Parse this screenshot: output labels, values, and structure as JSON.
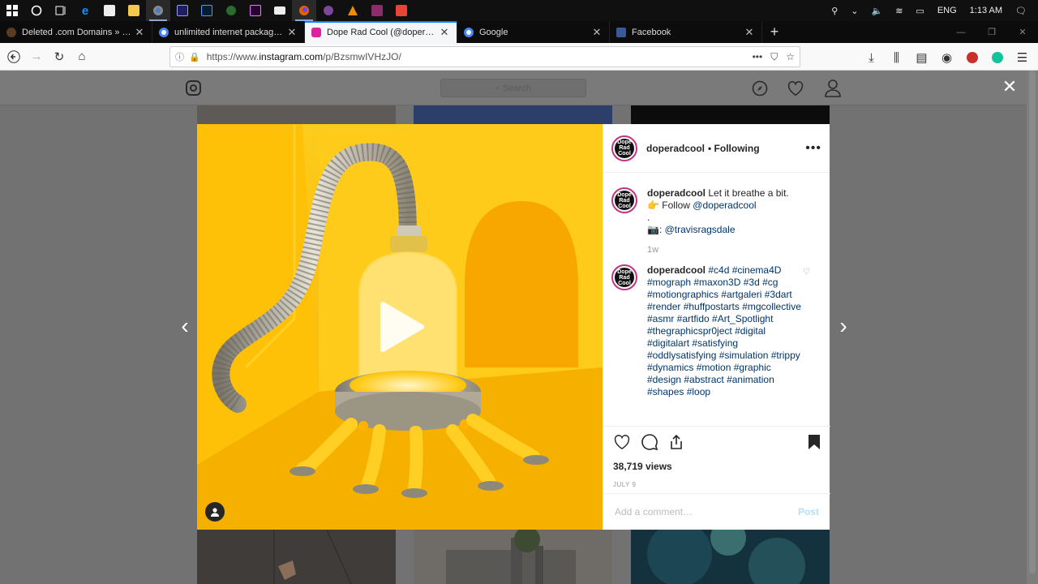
{
  "taskbar": {
    "icons": [
      "windows-start",
      "cortana-search",
      "task-view",
      "edge",
      "store",
      "file-explorer",
      "chrome",
      "after-effects",
      "photoshop",
      "corel",
      "premiere",
      "mail",
      "firefox",
      "tor",
      "vlc",
      "winrar",
      "app"
    ],
    "tray": {
      "lang": "ENG",
      "time": "1:13 AM"
    }
  },
  "tabs": [
    {
      "title": "Deleted .com Domains » Expir",
      "favicon_color": "#5b3b26",
      "active": false
    },
    {
      "title": "unlimited internet package - G",
      "favicon_color": "#4285f4",
      "active": false
    },
    {
      "title": "Dope Rad Cool (@doperadcoo",
      "favicon_color": "#d6249f",
      "active": true
    },
    {
      "title": "Google",
      "favicon_color": "#4285f4",
      "active": false
    },
    {
      "title": "Facebook",
      "favicon_color": "#3b5998",
      "active": false
    }
  ],
  "url": {
    "prefix": "https://www.",
    "host": "instagram.com",
    "path": "/p/BzsmwIVHzJO/"
  },
  "instagram": {
    "search_placeholder": "Search",
    "post": {
      "username": "doperadcool",
      "follow_status": "• Following",
      "caption": {
        "username": "doperadcool",
        "line1": "Let it breathe a bit.",
        "line2_prefix": "👉 Follow ",
        "line2_link": "@doperadcool",
        "line3": ".",
        "line4_prefix": "📷: ",
        "line4_link": "@travisragsdale",
        "time_ago": "1w"
      },
      "comment": {
        "username": "doperadcool",
        "hashtags": "#c4d #cinema4D #mograph #maxon3D #3d #cg #motiongraphics #artgaleri #3dart #render #huffpostarts #mgcollective #asmr #artfido #Art_Spotlight #thegraphicspr0ject #digital #digitalart #satisfying #oddlysatisfying #simulation #trippy #dynamics #motion #graphic #design #abstract #animation #shapes #loop"
      },
      "views": "38,719 views",
      "date": "JULY 9",
      "add_comment_placeholder": "Add a comment…",
      "post_button": "Post",
      "avatar_text": "Dope Rad Cool"
    }
  },
  "colors": {
    "tab_accent": "#0a84ff",
    "ig_link": "#003569",
    "media_bg": "#f7b500",
    "avatar_ring": "#c13584"
  }
}
